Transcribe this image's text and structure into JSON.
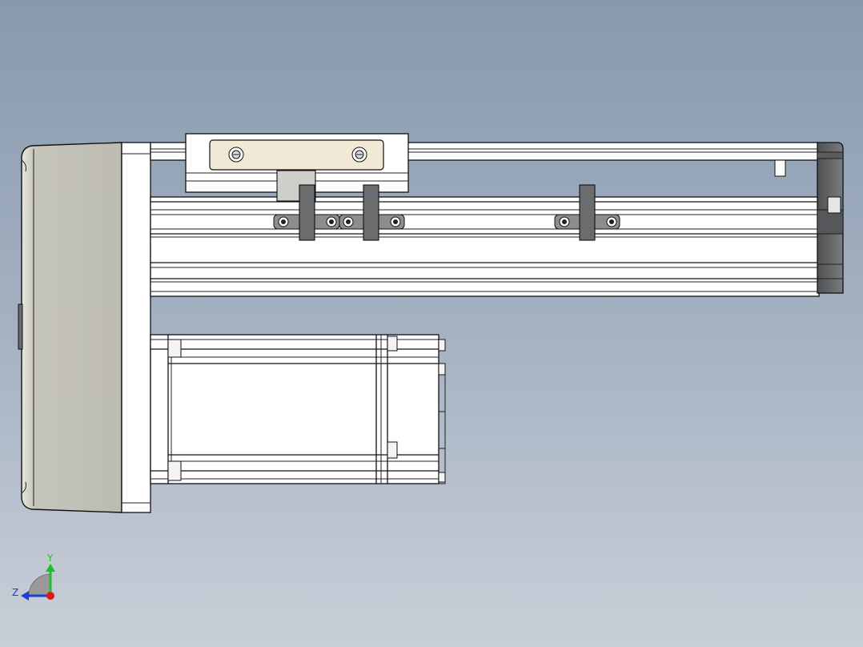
{
  "viewport": {
    "background_top": "#8899ae",
    "background_bottom": "#c9cfd8"
  },
  "model": {
    "part_colors": {
      "motor_cover": "#c6c5bc",
      "carriage_plate": "#f1e9d6",
      "clamps_and_endcap": "#6a6c6e",
      "aluminum_body": "#ffffff"
    }
  },
  "triad": {
    "y_label": "Y",
    "z_label": "Z",
    "y_color": "#1fc12a",
    "z_color": "#1b3fd6",
    "x_color": "#e01717"
  }
}
